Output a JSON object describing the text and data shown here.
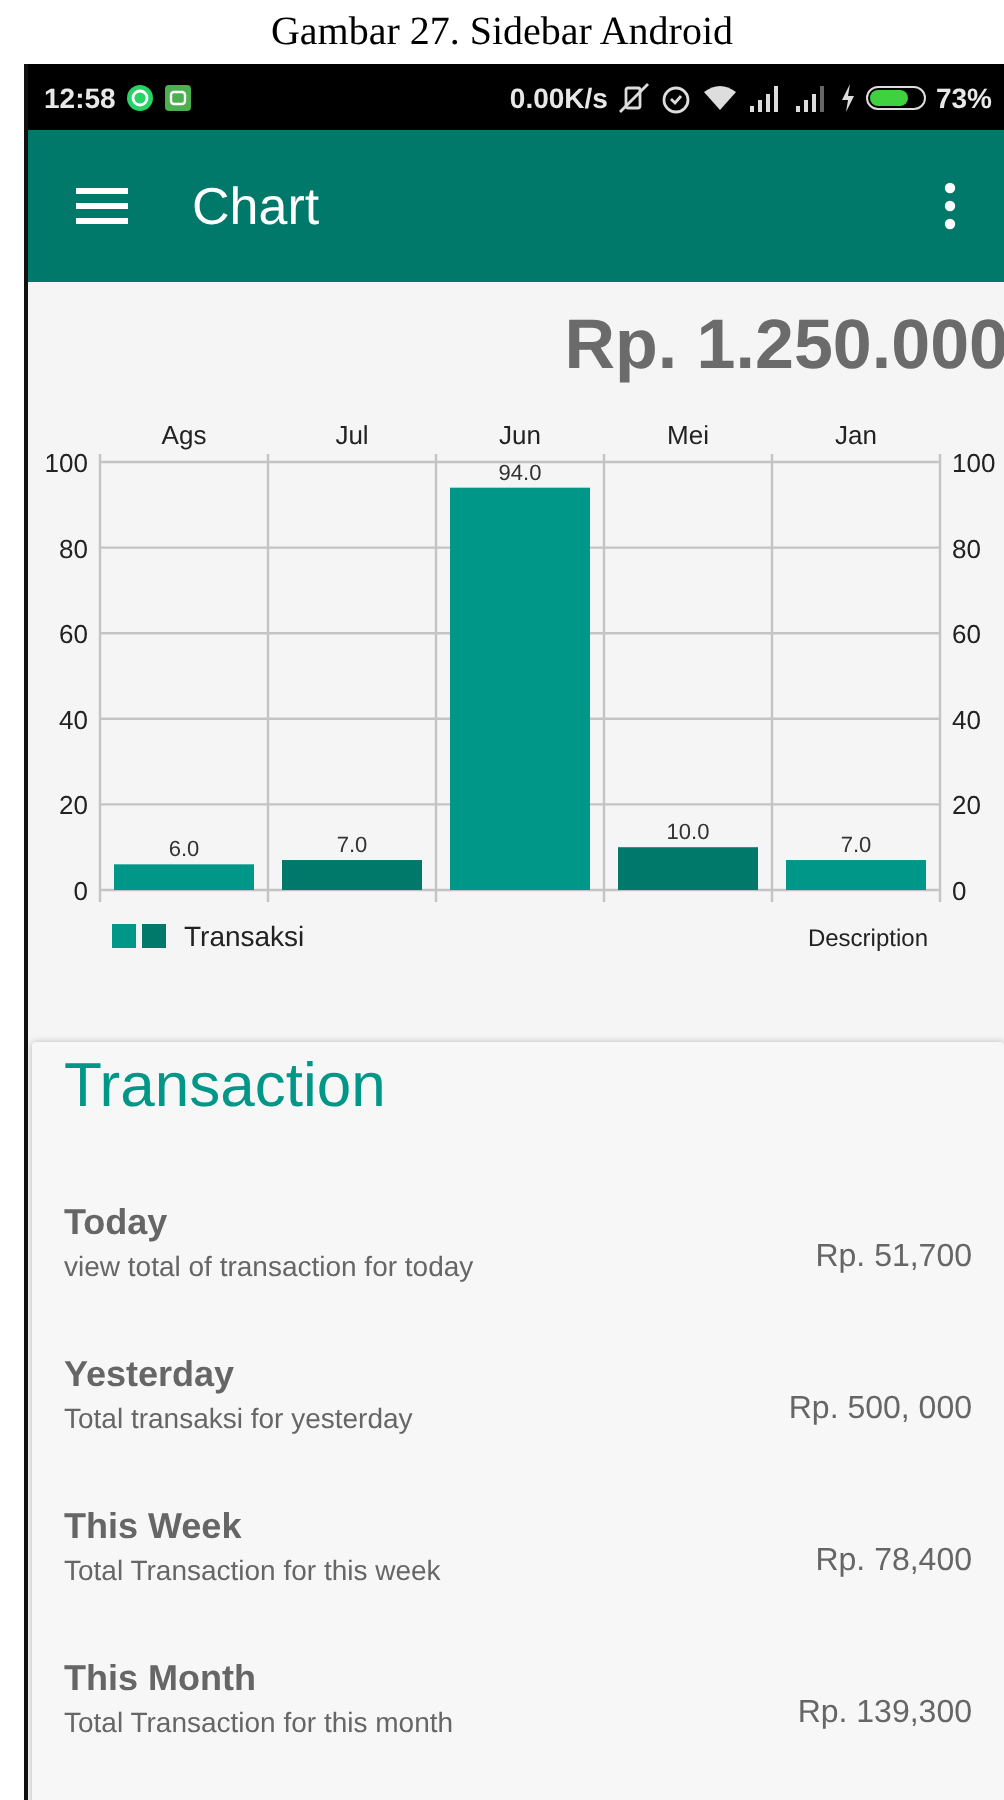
{
  "caption": "Gambar 27. Sidebar Android",
  "status_bar": {
    "time": "12:58",
    "speed": "0.00K/s",
    "battery": "73%"
  },
  "app_bar": {
    "title": "Chart"
  },
  "total": "Rp. 1.250.000",
  "chart": {
    "description": "Description",
    "chart_data": {
      "type": "bar",
      "categories": [
        "Ags",
        "Jul",
        "Jun",
        "Mei",
        "Jan"
      ],
      "series": [
        {
          "name": "Transaksi",
          "colors": [
            "#009688",
            "#00796b",
            "#009688",
            "#00796b",
            "#009688"
          ],
          "values": [
            6.0,
            7.0,
            94.0,
            10.0,
            7.0
          ]
        }
      ],
      "ylim": [
        0,
        100
      ],
      "yticks": [
        0,
        20,
        40,
        60,
        80,
        100
      ],
      "y2ticks": [
        0,
        20,
        40,
        60,
        80,
        100
      ],
      "y2lim": [
        0,
        100
      ],
      "grid": true,
      "value_labels": [
        "6.0",
        "7.0",
        "94.0",
        "10.0",
        "7.0"
      ]
    }
  },
  "transactions": {
    "title": "Transaction",
    "items": [
      {
        "title": "Today",
        "description": "view total of transaction for today",
        "amount": "Rp. 51,700"
      },
      {
        "title": "Yesterday",
        "description": "Total transaksi for yesterday",
        "amount": "Rp. 500, 000"
      },
      {
        "title": "This Week",
        "description": "Total Transaction for this week",
        "amount": "Rp. 78,400"
      },
      {
        "title": "This Month",
        "description": "Total Transaction for this month",
        "amount": "Rp. 139,300"
      }
    ]
  }
}
